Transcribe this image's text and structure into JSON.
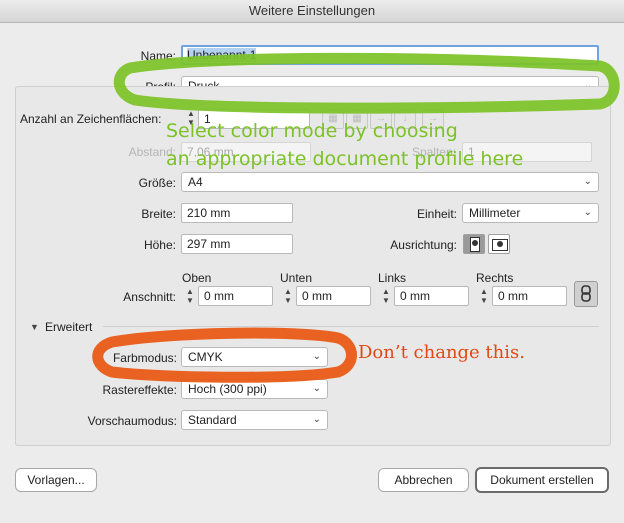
{
  "window": {
    "title": "Weitere Einstellungen"
  },
  "name": {
    "label": "Name:",
    "value": "Unbenannt-1"
  },
  "profil": {
    "label": "Profil:",
    "value": "Druck"
  },
  "artboards": {
    "count_label": "Anzahl an Zeichenflächen:",
    "count_value": "1",
    "spacing_label": "Abstand:",
    "spacing_value": "7,06 mm",
    "columns_label": "Spalten:",
    "columns_value": "1"
  },
  "size": {
    "label": "Größe:",
    "value": "A4"
  },
  "width": {
    "label": "Breite:",
    "value": "210 mm"
  },
  "unit": {
    "label": "Einheit:",
    "value": "Millimeter"
  },
  "height": {
    "label": "Höhe:",
    "value": "297 mm"
  },
  "orientation": {
    "label": "Ausrichtung:",
    "selected": "portrait"
  },
  "bleed": {
    "label": "Anschnitt:",
    "top_label": "Oben",
    "top_value": "0 mm",
    "bottom_label": "Unten",
    "bottom_value": "0 mm",
    "left_label": "Links",
    "left_value": "0 mm",
    "right_label": "Rechts",
    "right_value": "0 mm"
  },
  "advanced": {
    "label": "Erweitert",
    "color_mode_label": "Farbmodus:",
    "color_mode_value": "CMYK",
    "raster_label": "Rastereffekte:",
    "raster_value": "Hoch (300 ppi)",
    "preview_label": "Vorschaumodus:",
    "preview_value": "Standard"
  },
  "buttons": {
    "templates": "Vorlagen...",
    "cancel": "Abbrechen",
    "create": "Dokument erstellen"
  },
  "annotations": {
    "profile_note_line1": "Select color mode by choosing",
    "profile_note_line2": "an appropriate document profile here",
    "color_note": "Don’t change this.",
    "green_color": "#7cc226",
    "red_color": "#e8560f"
  }
}
